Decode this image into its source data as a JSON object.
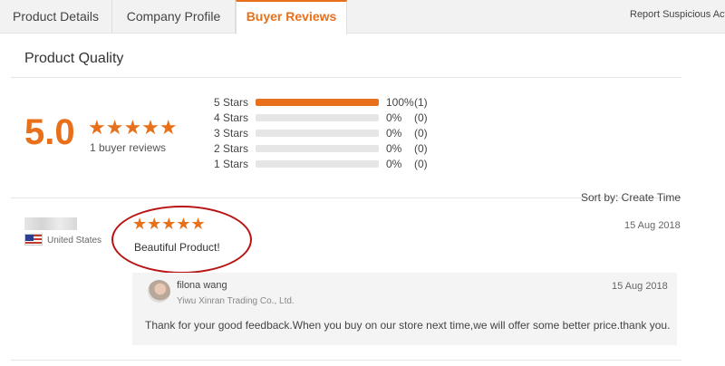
{
  "tabs": [
    {
      "label": "Product Details"
    },
    {
      "label": "Company Profile"
    },
    {
      "label": "Buyer Reviews"
    }
  ],
  "report_link": "Report Suspicious Activity",
  "section_title": "Product Quality",
  "summary": {
    "score": "5.0",
    "stars": "★★★★★",
    "star_rating": 5,
    "review_count": "1 buyer reviews"
  },
  "distribution": [
    {
      "label": "5 Stars",
      "pct": "100%",
      "count": "(1)",
      "fraction": 1.0
    },
    {
      "label": "4 Stars",
      "pct": "0%",
      "count": "(0)",
      "fraction": 0
    },
    {
      "label": "3 Stars",
      "pct": "0%",
      "count": "(0)",
      "fraction": 0
    },
    {
      "label": "2 Stars",
      "pct": "0%",
      "count": "(0)",
      "fraction": 0
    },
    {
      "label": "1 Stars",
      "pct": "0%",
      "count": "(0)",
      "fraction": 0
    }
  ],
  "sort_label": "Sort by: Create Time",
  "review": {
    "country": "United States",
    "stars": "★★★★★",
    "star_rating": 5,
    "date": "15 Aug 2018",
    "text": "Beautiful Product!",
    "reply": {
      "name": "filona wang",
      "company": "Yiwu Xinran Trading Co., Ltd.",
      "date": "15 Aug 2018",
      "text": "Thank for your good feedback.When you buy on our store next time,we will offer some better price.thank you."
    }
  },
  "colors": {
    "accent": "#e8701a",
    "annotation_circle": "#b81414"
  }
}
